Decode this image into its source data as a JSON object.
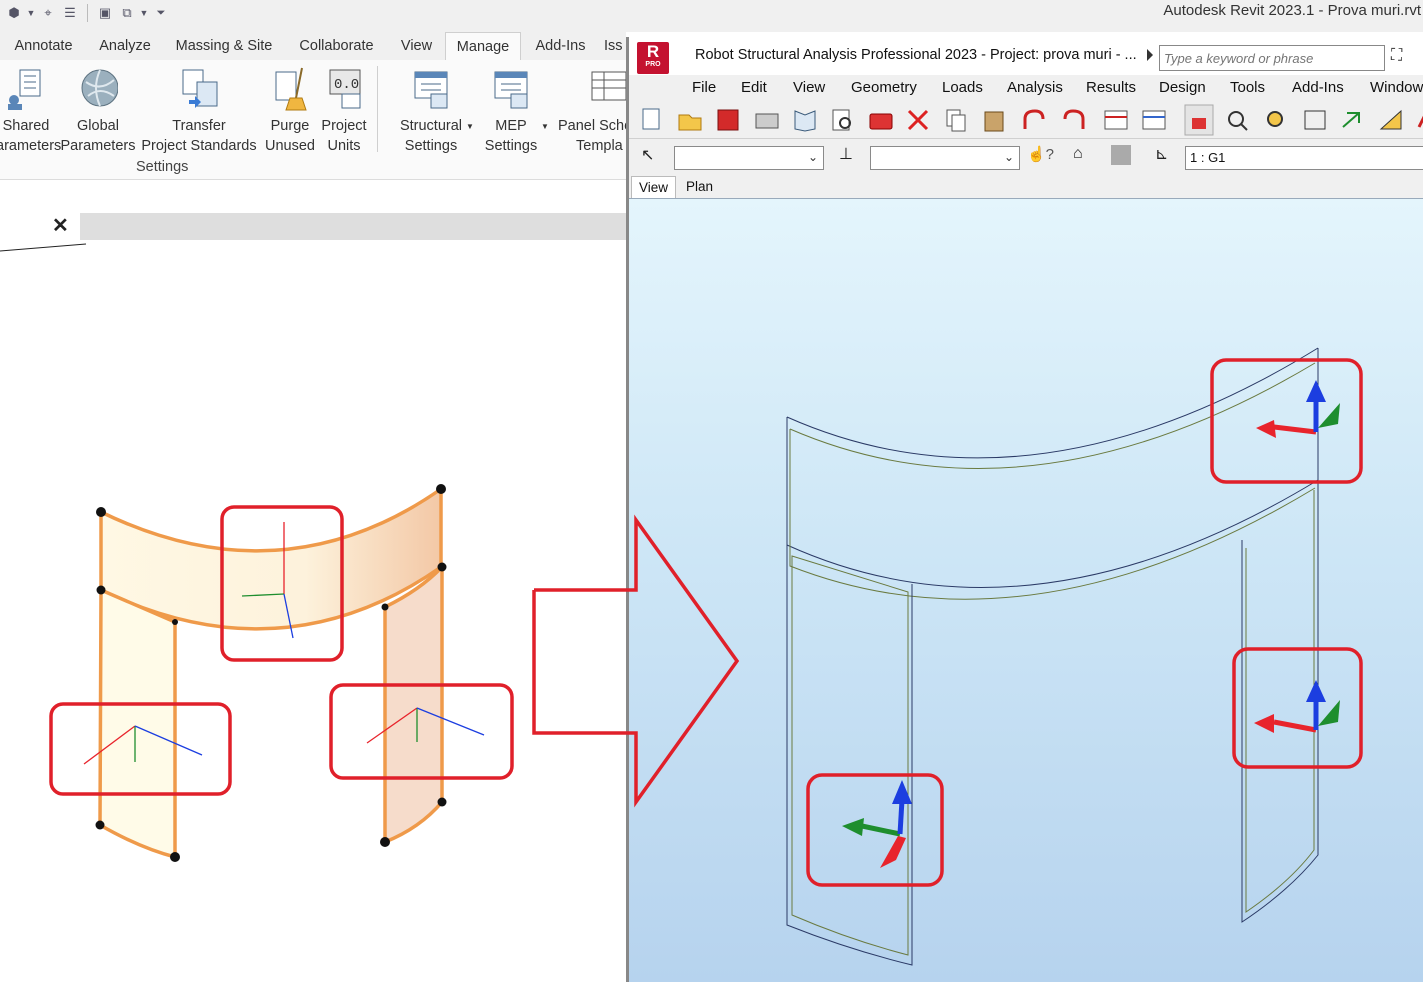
{
  "revit": {
    "window_title": "Autodesk Revit 2023.1 - Prova muri.rvt",
    "tabs": [
      "Annotate",
      "Analyze",
      "Massing & Site",
      "Collaborate",
      "View",
      "Manage",
      "Add-Ins",
      "Iss"
    ],
    "active_tab": "Manage",
    "ribbon_buttons": [
      {
        "line1": "Shared",
        "line2": "arameters"
      },
      {
        "line1": "Global",
        "line2": "Parameters"
      },
      {
        "line1": "Transfer",
        "line2": "Project Standards"
      },
      {
        "line1": "Purge",
        "line2": "Unused"
      },
      {
        "line1": "Project",
        "line2": "Units"
      },
      {
        "line1": "Structural",
        "line2": "Settings"
      },
      {
        "line1": "MEP",
        "line2": "Settings"
      },
      {
        "line1": "Panel Sche",
        "line2": "Templa"
      }
    ],
    "panel_label": "Settings",
    "view_close": "✕"
  },
  "robot": {
    "logo_letter": "R",
    "logo_badge": "PRO",
    "window_title": "Robot Structural Analysis Professional 2023 - Project: prova muri - ...",
    "search_placeholder": "Type a keyword or phrase",
    "menu": [
      "File",
      "Edit",
      "View",
      "Geometry",
      "Loads",
      "Analysis",
      "Results",
      "Design",
      "Tools",
      "Add-Ins",
      "Window"
    ],
    "view_name": "1 : G1",
    "view_tabs": [
      "View",
      "Plan"
    ],
    "active_view_tab": "View"
  },
  "colors": {
    "highlight_red": "#e0202a",
    "wall_orange": "#ef9a4a",
    "wall_fill": "#fdf6e0",
    "axis_x": "#e8242c",
    "axis_y": "#1e8e2e",
    "axis_z": "#1c3ee0"
  }
}
